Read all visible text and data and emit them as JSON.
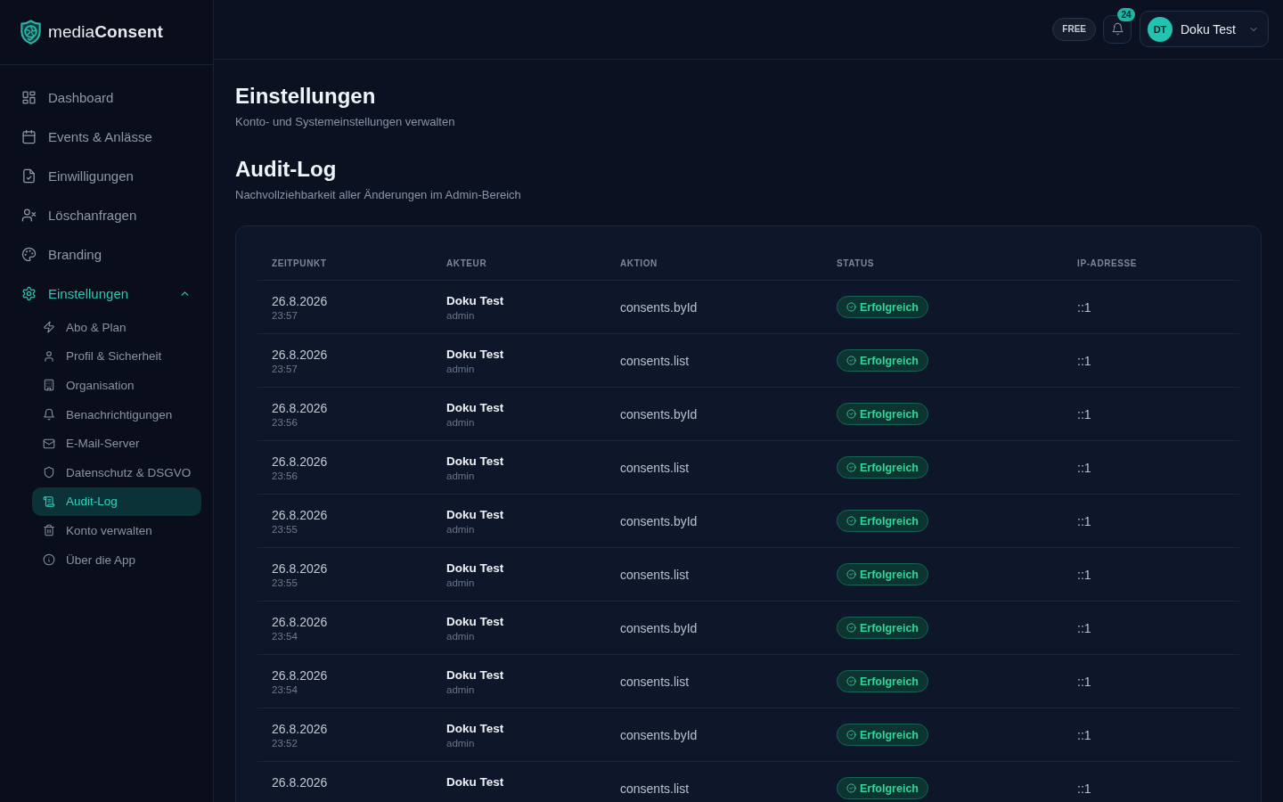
{
  "sidebar": {
    "logo": "media**Consent**",
    "items": [
      {
        "label": "Dashboard",
        "selected": false
      },
      {
        "label": "Events & Anlässe",
        "selected": false
      },
      {
        "label": "Einwilligungen",
        "selected": false
      },
      {
        "label": "Löschanfragen",
        "selected": false
      },
      {
        "label": "Branding",
        "selected": false
      },
      {
        "label": "Einstellungen",
        "selected": true,
        "expanded": true,
        "children": [
          {
            "label": "Abo & Plan",
            "selected": false
          },
          {
            "label": "Profil & Sicherheit",
            "selected": false
          },
          {
            "label": "Organisation",
            "selected": false
          },
          {
            "label": "Benachrichtigungen",
            "selected": false
          },
          {
            "label": "E-Mail-Server",
            "selected": false
          },
          {
            "label": "Datenschutz & DSGVO",
            "selected": false
          },
          {
            "label": "Audit-Log",
            "selected": true
          },
          {
            "label": "Konto verwalten",
            "selected": false
          },
          {
            "label": "Über die App",
            "selected": false
          }
        ]
      }
    ]
  },
  "topbar": {
    "plan_badge": "FREE",
    "notifications": {
      "count": "24"
    },
    "user": {
      "initials": "DT",
      "name": "Doku Test"
    }
  },
  "page": {
    "title": "Einstellungen",
    "subtitle": "Konto- und Systemeinstellungen verwalten"
  },
  "section": {
    "title": "Audit-Log",
    "subtitle": "Nachvollziehbarkeit aller Änderungen im Admin-Bereich"
  },
  "table": {
    "columns": [
      "ZEITPUNKT",
      "AKTEUR",
      "AKTION",
      "STATUS",
      "IP-ADRESSE"
    ],
    "rows": [
      {
        "date": "26.8.2026",
        "time": "23:57",
        "actor": "Doku Test",
        "role": "admin",
        "action": "consents.byId",
        "status": {
          "label": "Erfolgreich",
          "kind": "success"
        },
        "ip": "::1"
      },
      {
        "date": "26.8.2026",
        "time": "23:57",
        "actor": "Doku Test",
        "role": "admin",
        "action": "consents.list",
        "status": {
          "label": "Erfolgreich",
          "kind": "success"
        },
        "ip": "::1"
      },
      {
        "date": "26.8.2026",
        "time": "23:56",
        "actor": "Doku Test",
        "role": "admin",
        "action": "consents.byId",
        "status": {
          "label": "Erfolgreich",
          "kind": "success"
        },
        "ip": "::1"
      },
      {
        "date": "26.8.2026",
        "time": "23:56",
        "actor": "Doku Test",
        "role": "admin",
        "action": "consents.list",
        "status": {
          "label": "Erfolgreich",
          "kind": "success"
        },
        "ip": "::1"
      },
      {
        "date": "26.8.2026",
        "time": "23:55",
        "actor": "Doku Test",
        "role": "admin",
        "action": "consents.byId",
        "status": {
          "label": "Erfolgreich",
          "kind": "success"
        },
        "ip": "::1"
      },
      {
        "date": "26.8.2026",
        "time": "23:55",
        "actor": "Doku Test",
        "role": "admin",
        "action": "consents.list",
        "status": {
          "label": "Erfolgreich",
          "kind": "success"
        },
        "ip": "::1"
      },
      {
        "date": "26.8.2026",
        "time": "23:54",
        "actor": "Doku Test",
        "role": "admin",
        "action": "consents.byId",
        "status": {
          "label": "Erfolgreich",
          "kind": "success"
        },
        "ip": "::1"
      },
      {
        "date": "26.8.2026",
        "time": "23:54",
        "actor": "Doku Test",
        "role": "admin",
        "action": "consents.list",
        "status": {
          "label": "Erfolgreich",
          "kind": "success"
        },
        "ip": "::1"
      },
      {
        "date": "26.8.2026",
        "time": "23:52",
        "actor": "Doku Test",
        "role": "admin",
        "action": "consents.byId",
        "status": {
          "label": "Erfolgreich",
          "kind": "success"
        },
        "ip": "::1"
      },
      {
        "date": "26.8.2026",
        "actor": "Doku Test",
        "action": "consents.list",
        "status": {
          "label": "Erfolgreich",
          "kind": "success"
        },
        "ip": "::1"
      }
    ]
  }
}
